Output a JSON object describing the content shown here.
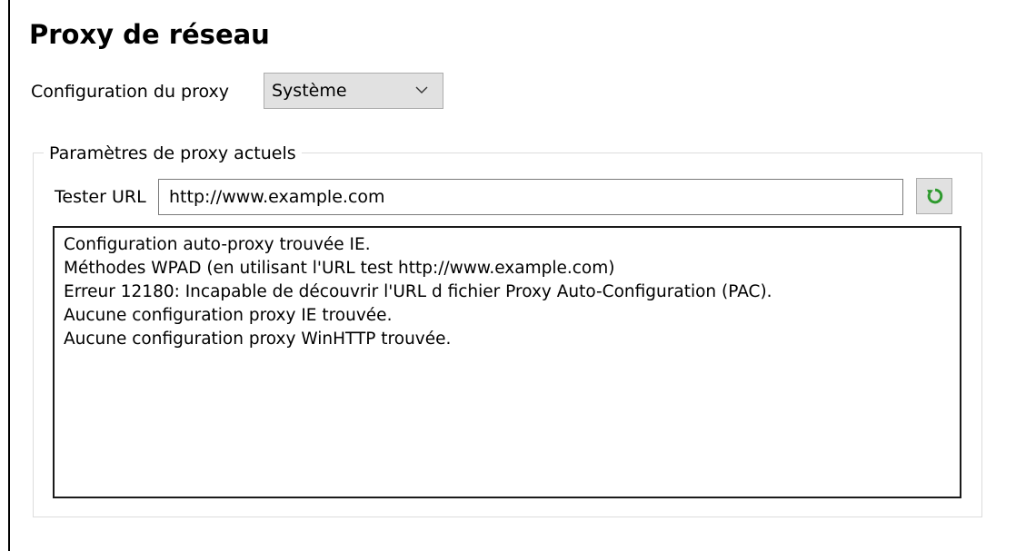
{
  "title": "Proxy de réseau",
  "proxy_config": {
    "label": "Configuration du proxy",
    "selected": "Système",
    "chevron_icon": "chevron-down-icon"
  },
  "current_settings": {
    "legend": "Paramètres de proxy actuels",
    "test_url_label": "Tester URL",
    "test_url_value": "http://www.example.com",
    "refresh_icon": "refresh-icon",
    "refresh_icon_color": "#2e9a2e",
    "output_lines": [
      "Configuration auto-proxy trouvée IE.",
      "Méthodes WPAD (en utilisant l'URL test http://www.example.com)",
      "Erreur 12180: Incapable de découvrir l'URL d fichier Proxy Auto-Configuration (PAC).",
      "Aucune configuration proxy IE trouvée.",
      "Aucune configuration proxy WinHTTP trouvée."
    ]
  }
}
